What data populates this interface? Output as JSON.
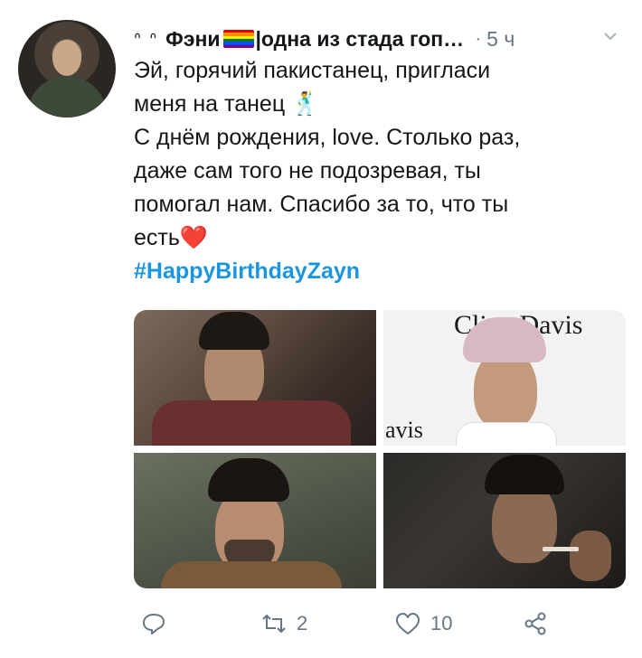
{
  "tweet": {
    "author_deco": "ᐢ ᐢ",
    "author_name": "Фэни",
    "author_name_rest": "|одна из стада гоп…",
    "dot": "·",
    "time": "5 ч",
    "text_lines": [
      "Эй, горячий пакистанец, пригласи",
      "меня на танец 🕺",
      "С днём рождения, love. Столько раз,",
      "даже сам того не подозревая, ты",
      "помогал нам. Спасибо за то, что ты",
      "есть"
    ],
    "heart_emoji": "❤️",
    "hashtag": "#HappyBirthdayZayn",
    "photo2_text_top": "Clive Davis",
    "photo2_text_bottom": "avis"
  },
  "actions": {
    "reply_count": "",
    "retweet_count": "2",
    "like_count": "10"
  },
  "colors": {
    "accent": "#1b95e0",
    "muted": "#657786",
    "heart": "#e0245e",
    "text": "#14171a"
  },
  "icons": [
    "reply-icon",
    "retweet-icon",
    "like-icon",
    "share-icon",
    "chevron-down-icon"
  ]
}
